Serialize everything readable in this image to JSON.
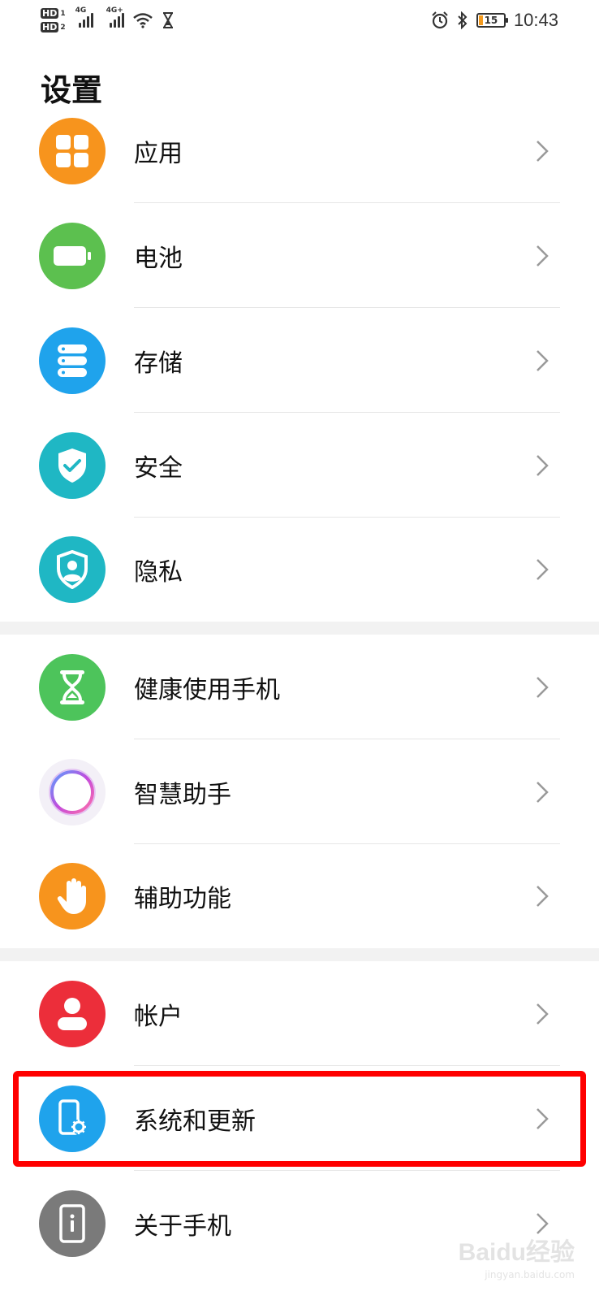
{
  "status_bar": {
    "hd1": "HD",
    "hd1_num": "1",
    "hd2": "HD",
    "hd2_num": "2",
    "net1": "4G",
    "net2": "4G+",
    "battery_level": "15",
    "battery_fraction": 0.15,
    "time": "10:43"
  },
  "page_title": "设置",
  "groups": [
    {
      "items": [
        {
          "label": "应用",
          "icon": "apps-icon",
          "color": "#f7941d"
        },
        {
          "label": "电池",
          "icon": "battery-icon",
          "color": "#5cc04f"
        },
        {
          "label": "存储",
          "icon": "storage-icon",
          "color": "#1fa3ec"
        },
        {
          "label": "安全",
          "icon": "shield-check-icon",
          "color": "#1fb7c4"
        },
        {
          "label": "隐私",
          "icon": "privacy-icon",
          "color": "#1fb7c4"
        }
      ]
    },
    {
      "items": [
        {
          "label": "健康使用手机",
          "icon": "hourglass-icon",
          "color": "#4dc45b"
        },
        {
          "label": "智慧助手",
          "icon": "assistant-ring-icon",
          "color": "#f3f0f7"
        },
        {
          "label": "辅助功能",
          "icon": "hand-icon",
          "color": "#f7941d"
        }
      ]
    },
    {
      "items": [
        {
          "label": "帐户",
          "icon": "account-icon",
          "color": "#ec2e3a"
        },
        {
          "label": "系统和更新",
          "icon": "phone-gear-icon",
          "color": "#1fa3ec"
        },
        {
          "label": "关于手机",
          "icon": "phone-info-icon",
          "color": "#7a7a7a"
        }
      ]
    }
  ],
  "highlight_color": "#ff0000",
  "watermark": {
    "main": "Baidu经验",
    "sub": "jingyan.baidu.com"
  }
}
